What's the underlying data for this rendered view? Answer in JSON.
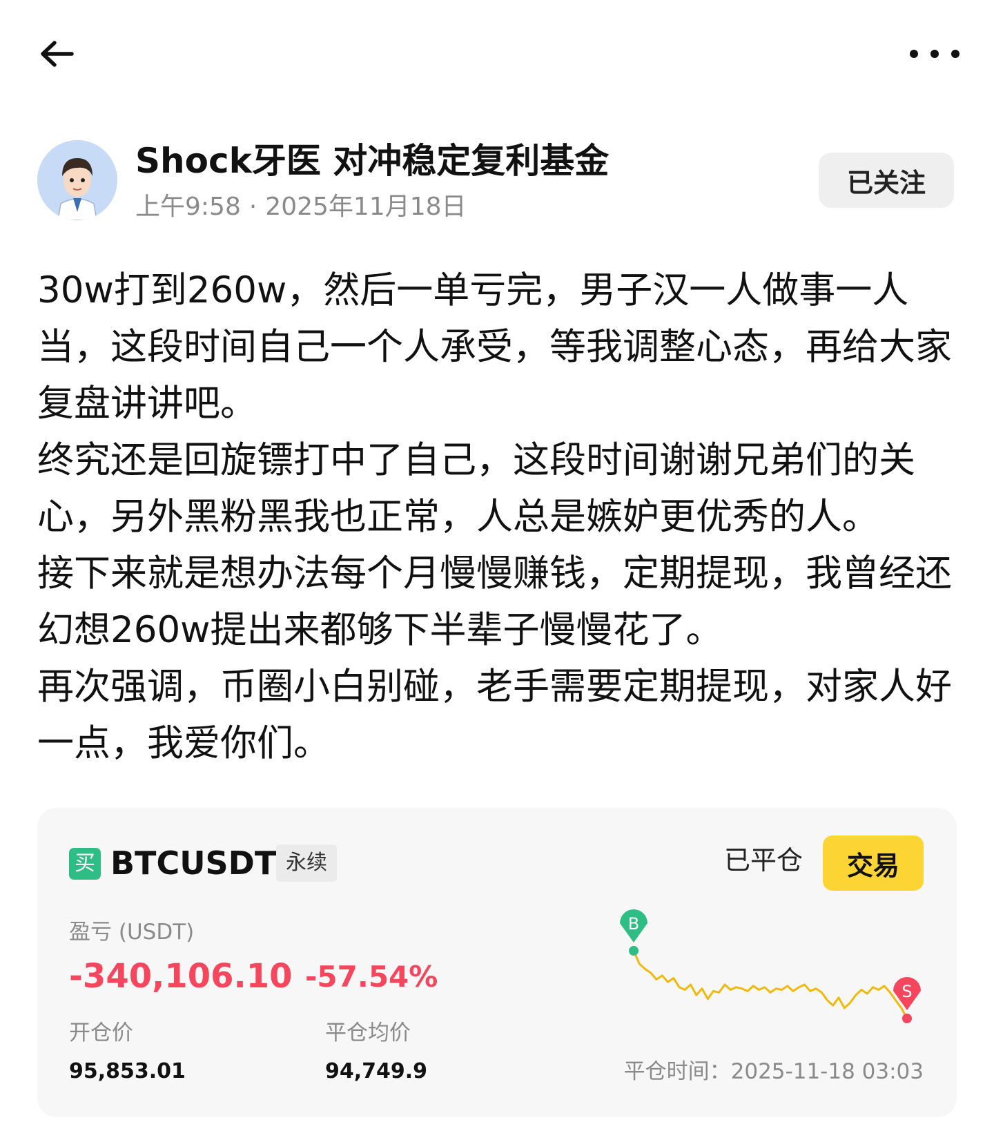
{
  "header": {
    "back_icon": "arrow-left-icon",
    "more_icon": "more-horizontal-icon"
  },
  "author": {
    "avatar_icon": "cartoon-dentist-avatar",
    "name": "Shock牙医 对冲稳定复利基金",
    "time": "上午9:58",
    "date": "2025年11月18日",
    "follow_label": "已关注"
  },
  "post": {
    "paragraphs": [
      "30w打到260w，然后一单亏完，男子汉一人做事一人当，这段时间自己一个人承受，等我调整心态，再给大家复盘讲讲吧。",
      "终究还是回旋镖打中了自己，这段时间谢谢兄弟们的关心，另外黑粉黑我也正常，人总是嫉妒更优秀的人。",
      "接下来就是想办法每个月慢慢赚钱，定期提现，我曾经还幻想260w提出来都够下半辈子慢慢花了。",
      "再次强调，币圈小白别碰，老手需要定期提现，对家人好一点，我爱你们。"
    ]
  },
  "trade_card": {
    "side_badge": "买",
    "symbol": "BTCUSDT",
    "contract_type": "永续",
    "status": "已平仓",
    "trade_button": "交易",
    "pnl_label": "盈亏 (USDT)",
    "pnl_value": "-340,106.10",
    "pnl_percent": "-57.54%",
    "open_price_label": "开仓价",
    "open_price": "95,853.01",
    "close_avg_label": "平仓均价",
    "close_avg": "94,749.9",
    "close_time_label": "平仓时间：",
    "close_time": "2025-11-18 03:03",
    "buy_marker": "B",
    "sell_marker": "S",
    "colors": {
      "buy": "#2ebd85",
      "sell": "#f6465d",
      "line": "#f0b90b",
      "trade_button": "#fcd535"
    }
  },
  "chart_data": {
    "type": "line",
    "y_relative": [
      100,
      90,
      86,
      83,
      78,
      81,
      76,
      79,
      72,
      70,
      74,
      66,
      71,
      63,
      69,
      68,
      74,
      70,
      72,
      71,
      69,
      73,
      70,
      72,
      68,
      71,
      70,
      73,
      69,
      72,
      74,
      69,
      71,
      68,
      62,
      58,
      64,
      56,
      60,
      66,
      70,
      67,
      72,
      70,
      73,
      68,
      62,
      56,
      48
    ],
    "entry_marker": "B",
    "exit_marker": "S"
  }
}
